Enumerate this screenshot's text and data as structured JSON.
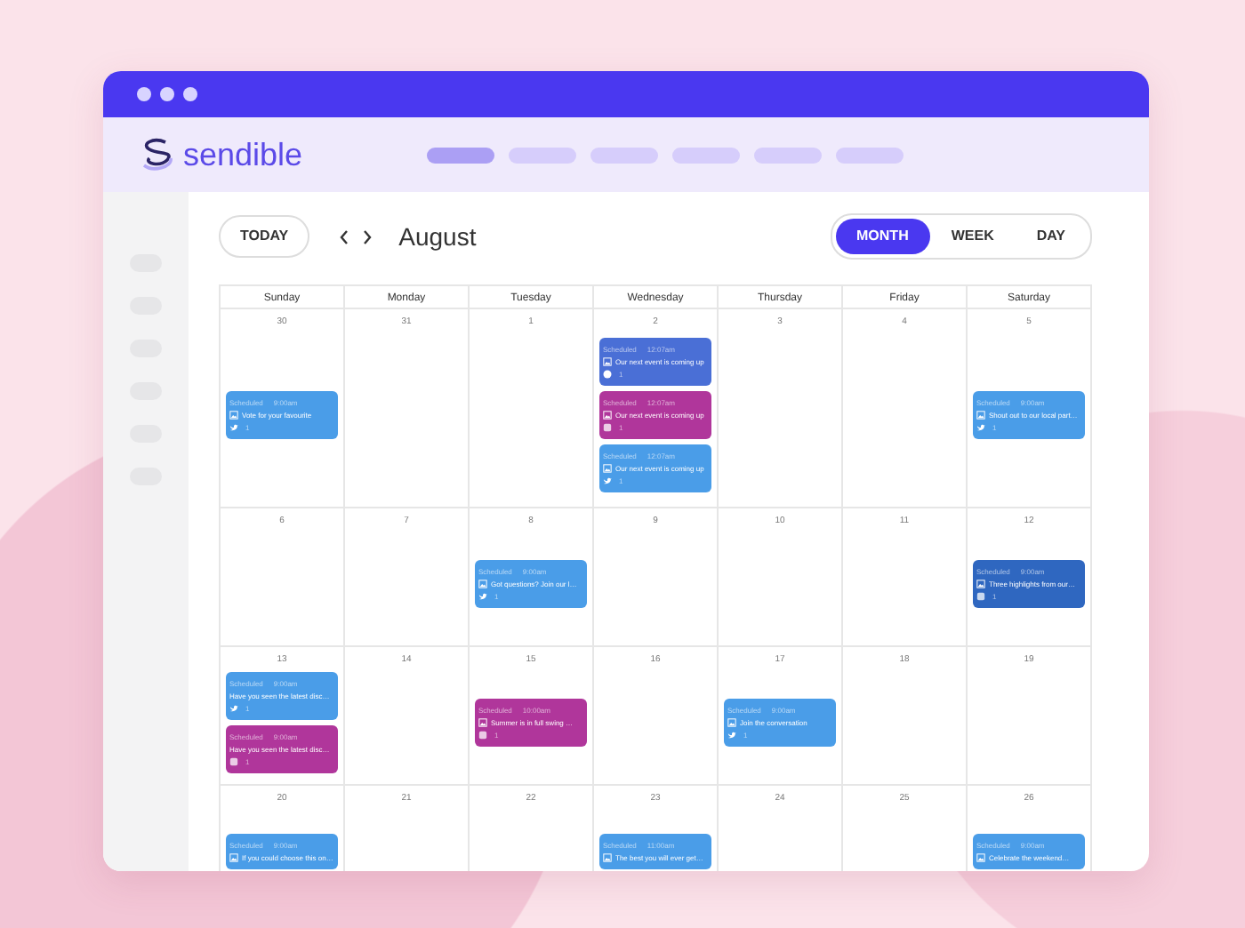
{
  "header": {
    "logo_text": "sendible",
    "nav_placeholders": [
      {
        "selected": true
      },
      {
        "selected": false
      },
      {
        "selected": false
      },
      {
        "selected": false
      },
      {
        "selected": false
      },
      {
        "selected": false
      }
    ]
  },
  "toolbar": {
    "today": "TODAY",
    "month": "August",
    "views": [
      {
        "label": "MONTH",
        "selected": true
      },
      {
        "label": "WEEK",
        "selected": false
      },
      {
        "label": "DAY",
        "selected": false
      }
    ]
  },
  "calendar": {
    "weekdays": [
      "Sunday",
      "Monday",
      "Tuesday",
      "Wednesday",
      "Thursday",
      "Friday",
      "Saturday"
    ],
    "weeks": [
      [
        {
          "day": "30",
          "events": [
            {
              "status": "Scheduled",
              "time": "9:00am",
              "title": "Vote for your favourite",
              "image": true,
              "kind": "bird",
              "count": "1",
              "color": "#4a9de8"
            }
          ]
        },
        {
          "day": "31"
        },
        {
          "day": "1"
        },
        {
          "day": "2",
          "events": [
            {
              "status": "Scheduled",
              "time": "12:07am",
              "title": "Our next event is coming up",
              "image": true,
              "kind": "round",
              "count": "1",
              "color": "#4a6fd6"
            },
            {
              "status": "Scheduled",
              "time": "12:07am",
              "title": "Our next event is coming up",
              "image": true,
              "kind": "square",
              "count": "1",
              "color": "#b0369b"
            },
            {
              "status": "Scheduled",
              "time": "12:07am",
              "title": "Our next event is coming up",
              "image": true,
              "kind": "bird",
              "count": "1",
              "color": "#4a9de8"
            }
          ]
        },
        {
          "day": "3"
        },
        {
          "day": "4"
        },
        {
          "day": "5",
          "events": [
            {
              "status": "Scheduled",
              "time": "9:00am",
              "title": "Shout out to our local part…",
              "image": true,
              "kind": "bird",
              "count": "1",
              "color": "#4a9de8"
            }
          ]
        }
      ],
      [
        {
          "day": "6"
        },
        {
          "day": "7"
        },
        {
          "day": "8",
          "events": [
            {
              "status": "Scheduled",
              "time": "9:00am",
              "title": "Got questions? Join our l…",
              "image": true,
              "kind": "bird",
              "count": "1",
              "color": "#4a9de8"
            }
          ]
        },
        {
          "day": "9"
        },
        {
          "day": "10"
        },
        {
          "day": "11"
        },
        {
          "day": "12",
          "events": [
            {
              "status": "Scheduled",
              "time": "9:00am",
              "title": "Three highlights from our…",
              "image": true,
              "kind": "square",
              "count": "1",
              "color": "#2f67c0"
            }
          ]
        }
      ],
      [
        {
          "day": "13",
          "events": [
            {
              "status": "Scheduled",
              "time": "9:00am",
              "title": "Have you seen the latest disc…",
              "image": false,
              "kind": "bird",
              "count": "1",
              "color": "#4a9de8"
            },
            {
              "status": "Scheduled",
              "time": "9:00am",
              "title": "Have you seen the latest disc…",
              "image": false,
              "kind": "square",
              "count": "1",
              "color": "#b0369b"
            }
          ]
        },
        {
          "day": "14"
        },
        {
          "day": "15",
          "events": [
            {
              "status": "Scheduled",
              "time": "10:00am",
              "title": "Summer is in full swing …",
              "image": true,
              "kind": "square",
              "count": "1",
              "color": "#b0369b"
            }
          ]
        },
        {
          "day": "16"
        },
        {
          "day": "17",
          "events": [
            {
              "status": "Scheduled",
              "time": "9:00am",
              "title": "Join the conversation",
              "image": true,
              "kind": "bird",
              "count": "1",
              "color": "#4a9de8"
            }
          ]
        },
        {
          "day": "18"
        },
        {
          "day": "19"
        }
      ],
      [
        {
          "day": "20",
          "events": [
            {
              "status": "Scheduled",
              "time": "9:00am",
              "title": "If you could choose this on…",
              "image": true,
              "color": "#4a9de8"
            }
          ]
        },
        {
          "day": "21"
        },
        {
          "day": "22"
        },
        {
          "day": "23",
          "events": [
            {
              "status": "Scheduled",
              "time": "11:00am",
              "title": "The best you will ever get…",
              "image": true,
              "color": "#4a9de8"
            }
          ]
        },
        {
          "day": "24"
        },
        {
          "day": "25"
        },
        {
          "day": "26",
          "events": [
            {
              "status": "Scheduled",
              "time": "9:00am",
              "title": "Celebrate the weekend…",
              "image": true,
              "color": "#4a9de8"
            }
          ]
        }
      ]
    ]
  }
}
